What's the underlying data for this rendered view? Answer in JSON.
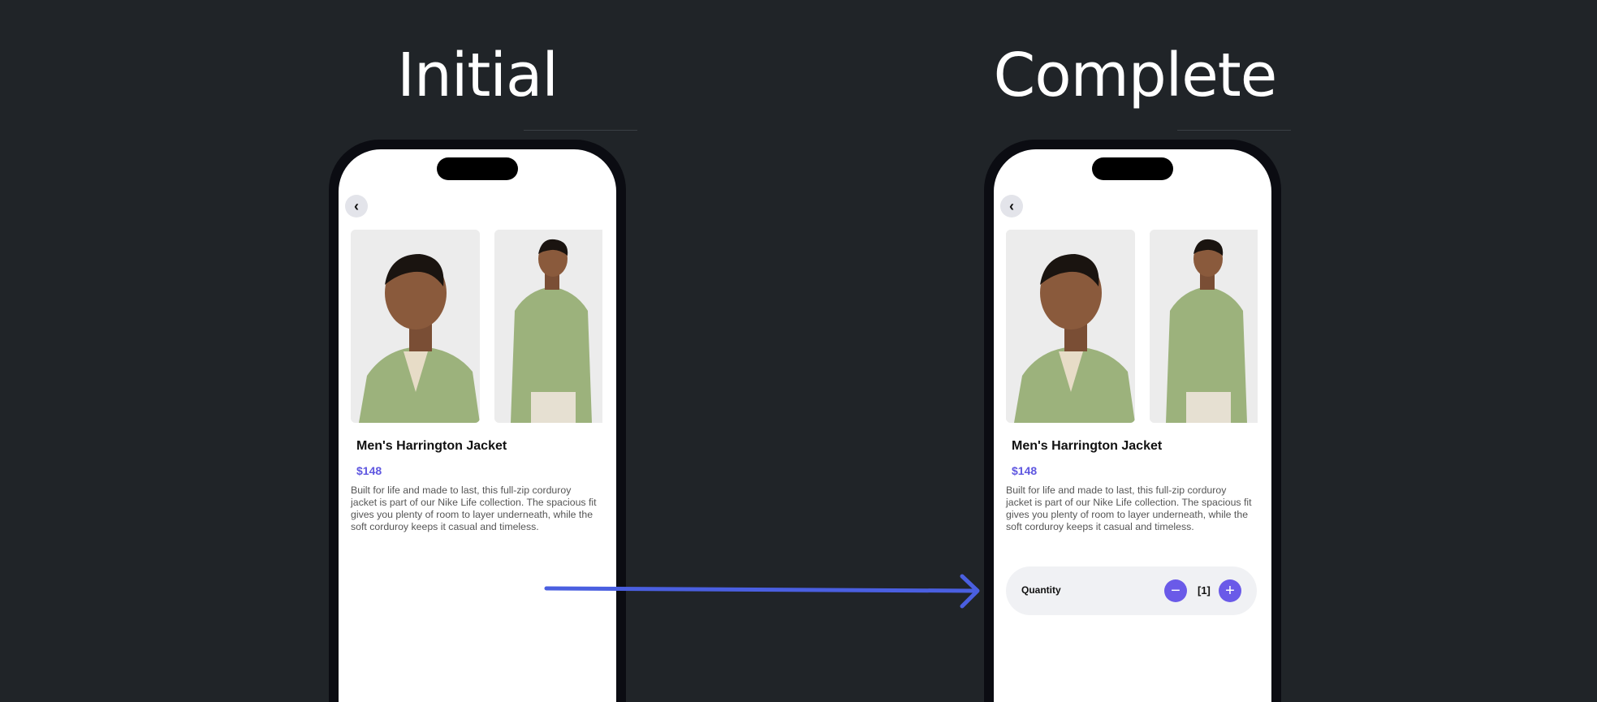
{
  "labels": {
    "initial": "Initial",
    "complete": "Complete"
  },
  "product": {
    "back_icon": "chevron-left-icon",
    "back_glyph": "‹",
    "title": "Men's Harrington Jacket",
    "price": "$148",
    "description": "Built for life and made to last, this full-zip corduroy jacket is part of our Nike Life collection. The spacious fit gives you plenty of room to layer underneath, while the soft corduroy keeps it casual and timeless."
  },
  "quantity": {
    "label": "Quantity",
    "value": "[1]",
    "minus_icon": "minus-icon",
    "plus_icon": "plus-icon",
    "minus_glyph": "−",
    "plus_glyph": "+"
  },
  "colors": {
    "background": "#202428",
    "accent": "#6a5ae8",
    "price": "#5f57e0",
    "arrow": "#4a5fe0",
    "jacket": "#9cb27c"
  }
}
